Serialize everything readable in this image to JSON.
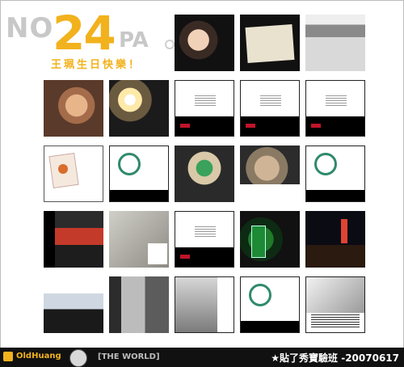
{
  "logo": {
    "part1": "NO",
    "part2": "24",
    "part3": "PA",
    "subtitle": "王珮生日快樂！"
  },
  "footer": {
    "brand": "OldHuang",
    "world": "[THE WORLD]",
    "right": "★貼了秀寶驗班 -20070617"
  }
}
